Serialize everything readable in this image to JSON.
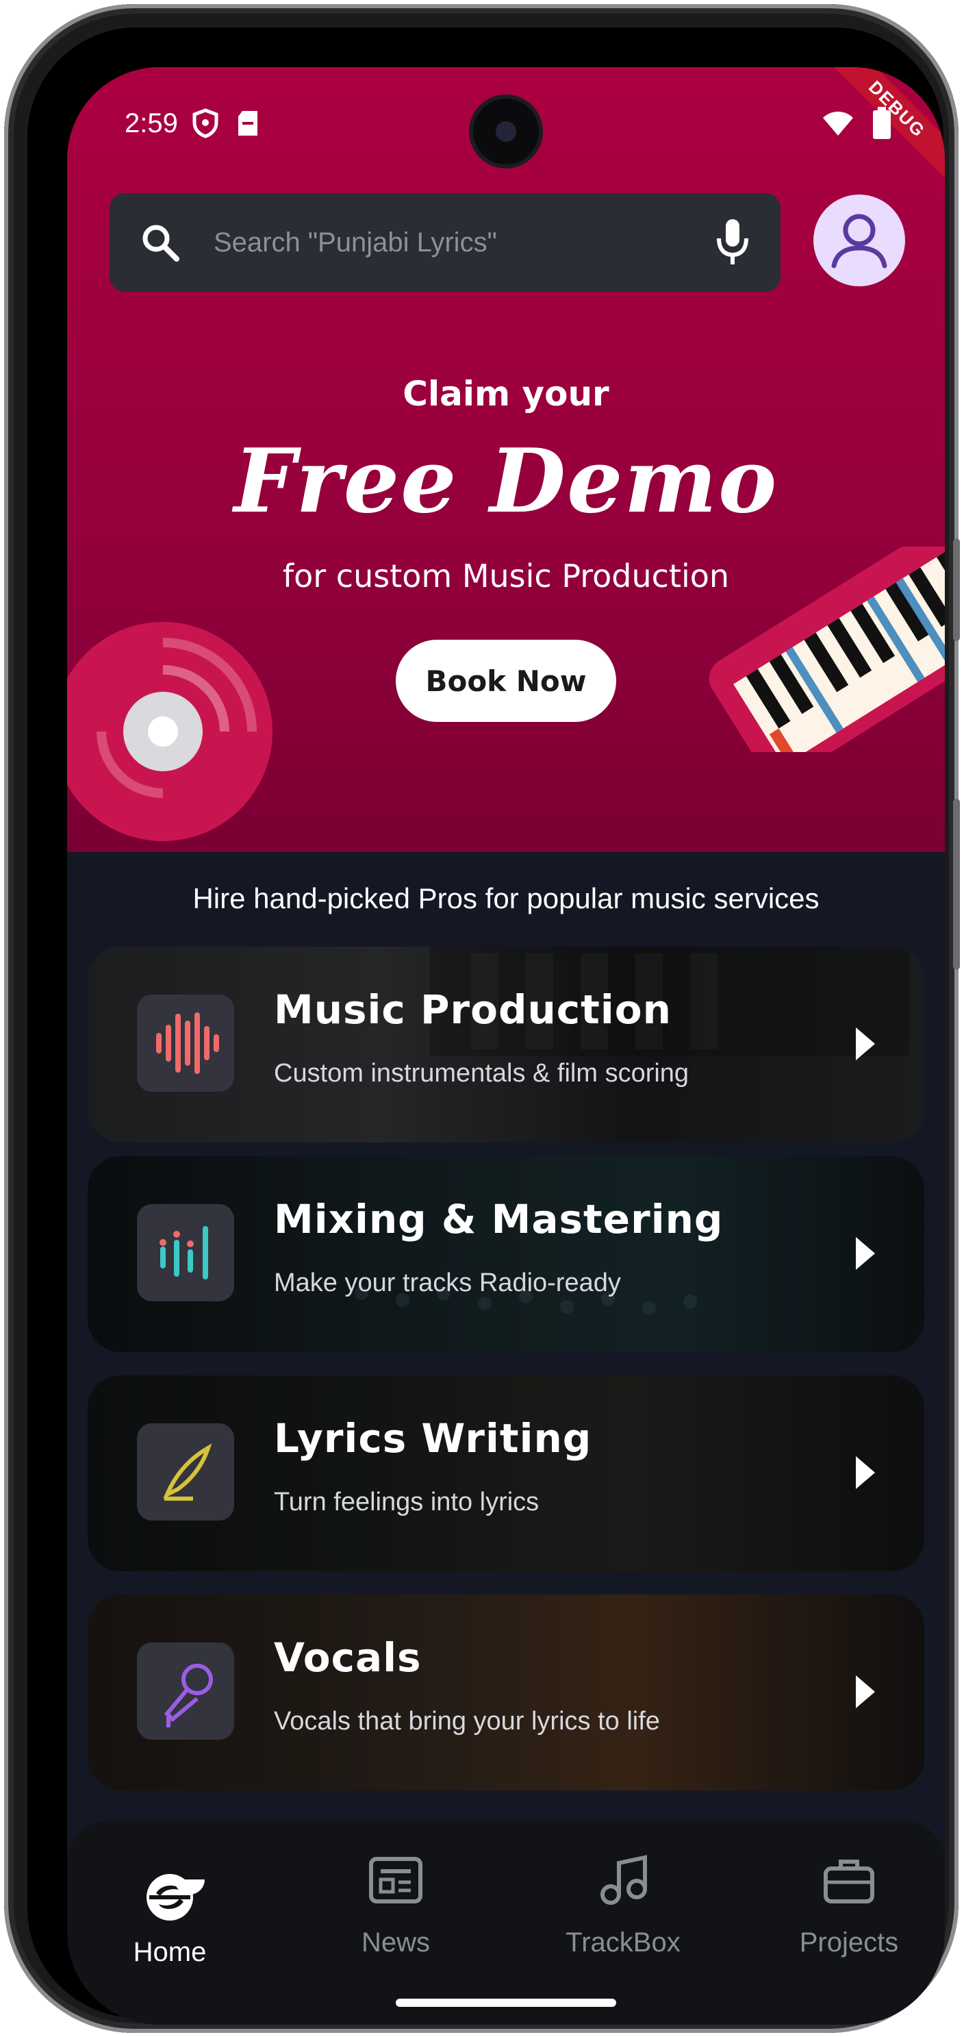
{
  "status_bar": {
    "time": "2:59",
    "debug_label": "DEBUG"
  },
  "search": {
    "placeholder": "Search \"Punjabi Lyrics\""
  },
  "banner": {
    "line1": "Claim your",
    "headline": "Free Demo",
    "line3": "for custom Music Production",
    "cta_label": "Book Now"
  },
  "services": {
    "heading": "Hire hand-picked Pros for popular music services",
    "items": [
      {
        "title": "Music Production",
        "subtitle": "Custom instrumentals & film scoring",
        "icon": "waveform-icon",
        "icon_color": "#f06a6a"
      },
      {
        "title": "Mixing & Mastering",
        "subtitle": "Make your tracks Radio-ready",
        "icon": "equalizer-icon",
        "icon_color": "#3ec8c8"
      },
      {
        "title": "Lyrics Writing",
        "subtitle": "Turn feelings into lyrics",
        "icon": "quill-icon",
        "icon_color": "#d8c23a"
      },
      {
        "title": "Vocals",
        "subtitle": "Vocals that bring your lyrics to life",
        "icon": "microphone-icon",
        "icon_color": "#9b5de5"
      }
    ]
  },
  "bottom_nav": {
    "items": [
      {
        "label": "Home",
        "icon": "home-logo-icon",
        "active": true
      },
      {
        "label": "News",
        "icon": "newspaper-icon",
        "active": false
      },
      {
        "label": "TrackBox",
        "icon": "music-note-icon",
        "active": false
      },
      {
        "label": "Projects",
        "icon": "briefcase-icon",
        "active": false
      }
    ]
  },
  "colors": {
    "hero": "#a3003f",
    "background": "#141824",
    "card_icon_box": "#33343d",
    "nav_bg": "#111317"
  }
}
